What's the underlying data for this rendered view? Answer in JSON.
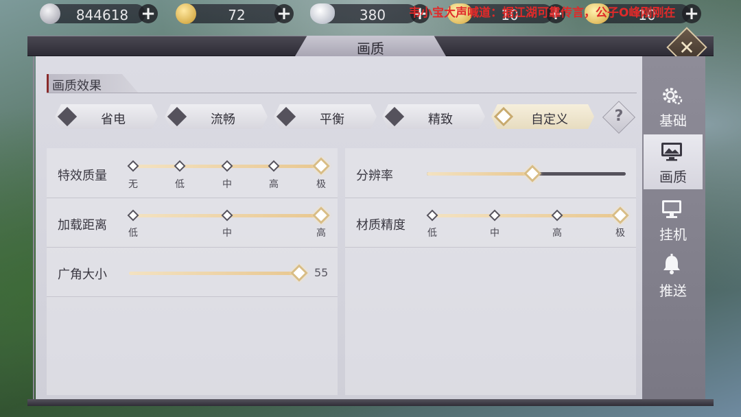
{
  "currencies": [
    {
      "name": "silver-coin",
      "value": "844618"
    },
    {
      "name": "gold-coin",
      "value": "72"
    },
    {
      "name": "silver-ingot",
      "value": "380"
    },
    {
      "name": "gold-ingot",
      "value": "10"
    },
    {
      "name": "gold-ingot-2",
      "value": "10"
    }
  ],
  "marquee": "韦小宝大声喊道：据江湖可靠传言，公子O峰刚刚在",
  "window": {
    "title": "画质",
    "close_icon": "close-icon"
  },
  "section": {
    "title": "画质效果"
  },
  "presets": [
    {
      "label": "省电",
      "active": false
    },
    {
      "label": "流畅",
      "active": false
    },
    {
      "label": "平衡",
      "active": false
    },
    {
      "label": "精致",
      "active": false
    },
    {
      "label": "自定义",
      "active": true
    }
  ],
  "help": {
    "label": "?"
  },
  "settings_left": [
    {
      "label": "特效质量",
      "ticks": [
        "无",
        "低",
        "中",
        "高",
        "极"
      ],
      "selected_index": 4
    },
    {
      "label": "加载距离",
      "ticks": [
        "低",
        "中",
        "高"
      ],
      "selected_index": 2
    },
    {
      "label": "广角大小",
      "value": "55",
      "fraction": 1.0
    }
  ],
  "settings_right": [
    {
      "label": "分辨率",
      "fraction": 0.55
    },
    {
      "label": "材质精度",
      "ticks": [
        "低",
        "中",
        "高",
        "极"
      ],
      "selected_index": 3
    }
  ],
  "sidebar": [
    {
      "label": "基础",
      "icon": "gear-icon",
      "active": false
    },
    {
      "label": "画质",
      "icon": "monitor-image-icon",
      "active": true
    },
    {
      "label": "挂机",
      "icon": "monitor-icon",
      "active": false
    },
    {
      "label": "推送",
      "icon": "bell-icon",
      "active": false
    }
  ],
  "colors": {
    "accent_gold": "#d8bd86",
    "panel": "#d6d6de",
    "marquee_red": "#e02a2a"
  }
}
